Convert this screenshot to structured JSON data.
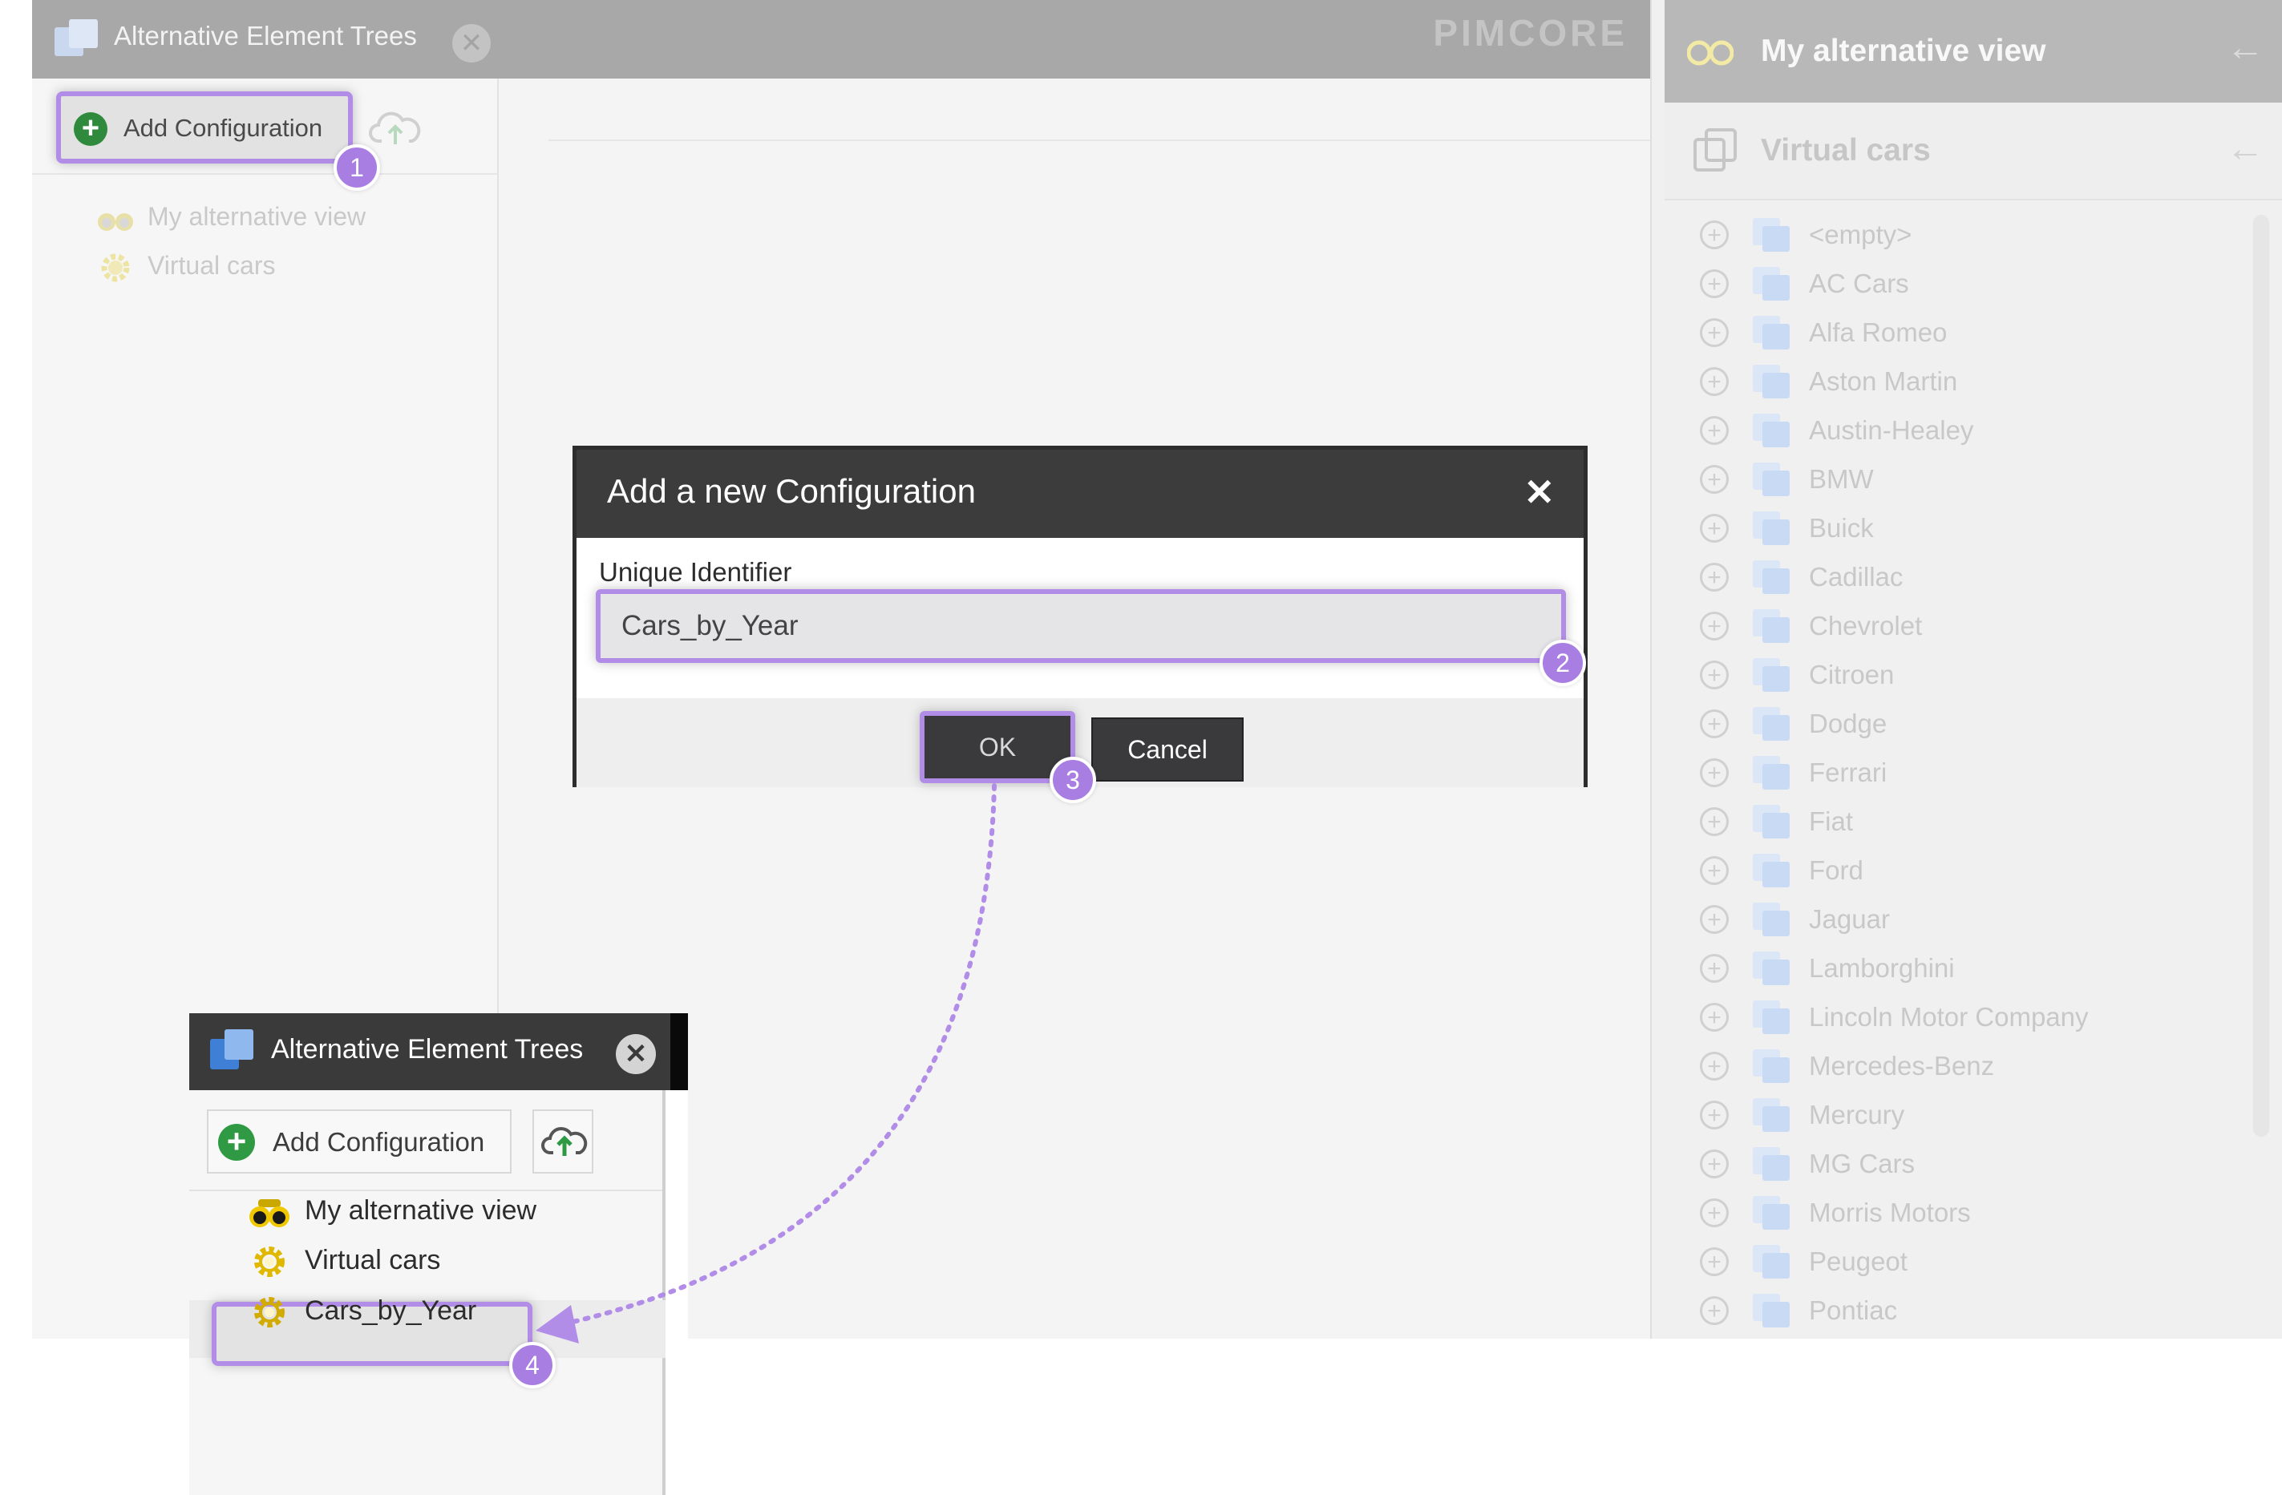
{
  "background": {
    "tab_title": "Alternative Element Trees",
    "logo_text": "PIMCORE",
    "add_configuration_label": "Add Configuration",
    "tree_items": [
      "My alternative view",
      "Virtual cars"
    ]
  },
  "right_panel": {
    "header_title": "My alternative view",
    "sub_title": "Virtual cars",
    "items": [
      "<empty>",
      "AC Cars",
      "Alfa Romeo",
      "Aston Martin",
      "Austin-Healey",
      "BMW",
      "Buick",
      "Cadillac",
      "Chevrolet",
      "Citroen",
      "Dodge",
      "Ferrari",
      "Fiat",
      "Ford",
      "Jaguar",
      "Lamborghini",
      "Lincoln Motor Company",
      "Mercedes-Benz",
      "Mercury",
      "MG Cars",
      "Morris Motors",
      "Peugeot",
      "Pontiac"
    ]
  },
  "dialog": {
    "title": "Add a new Configuration",
    "close_glyph": "✕",
    "field_label": "Unique Identifier",
    "field_value": "Cars_by_Year",
    "ok_label": "OK",
    "cancel_label": "Cancel"
  },
  "inset": {
    "tab_title": "Alternative Element Trees",
    "add_configuration_label": "Add Configuration",
    "tree_items": [
      "My alternative view",
      "Virtual cars",
      "Cars_by_Year"
    ]
  },
  "steps": [
    "1",
    "2",
    "3",
    "4"
  ],
  "colors": {
    "highlight": "#b28de8",
    "badge": "#a97ee3",
    "dialog_header": "#3c3c3c",
    "add_green": "#2f9a43",
    "folder_blue": "#4a90e2"
  },
  "icons": {
    "tab": "element-tree-icon",
    "add": "plus-circle-icon",
    "upload": "cloud-upload-icon",
    "view": "binoculars-icon",
    "config": "gear-icon",
    "folder": "folder-icon",
    "back": "arrow-left-icon"
  }
}
